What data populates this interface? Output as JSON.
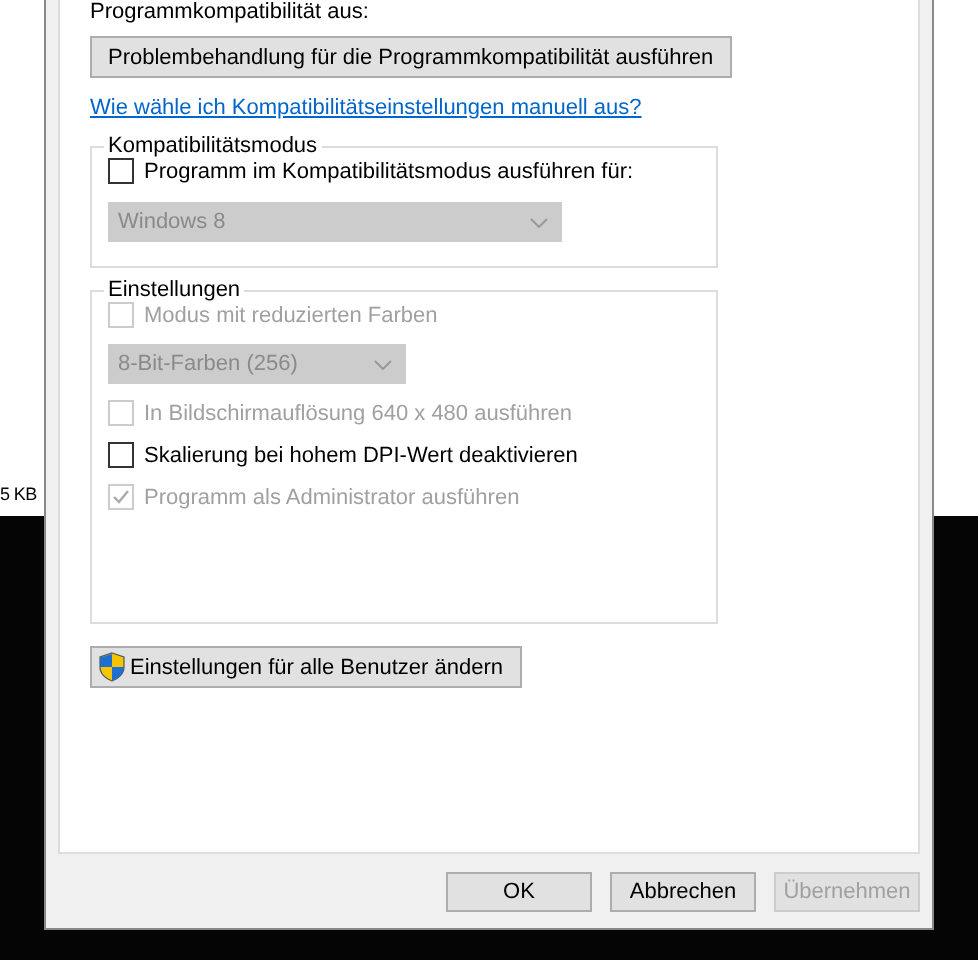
{
  "background_text": "5 KB",
  "intro_text": "Programmkompatibilität aus:",
  "troubleshoot_button": {
    "label": "Problembehandlung für die Programmkompatibilität ausführen"
  },
  "help_link": "Wie wähle ich Kompatibilitätseinstellungen manuell aus?",
  "compat_group": {
    "legend": "Kompatibilitätsmodus",
    "items": [
      {
        "kind": "checkbox",
        "label": "Programm im Kompatibilitätsmodus ausführen für:",
        "checked": false,
        "disabled": false
      },
      {
        "kind": "dropdown",
        "value": "Windows 8",
        "disabled": true
      }
    ]
  },
  "settings_group": {
    "legend": "Einstellungen",
    "items": [
      {
        "kind": "checkbox",
        "label": "Modus mit reduzierten Farben",
        "checked": false,
        "disabled": true
      },
      {
        "kind": "dropdown",
        "value": "8-Bit-Farben (256)",
        "disabled": true
      },
      {
        "kind": "checkbox",
        "label": "In Bildschirmauflösung 640 x 480 ausführen",
        "checked": false,
        "disabled": true
      },
      {
        "kind": "checkbox",
        "label": "Skalierung bei hohem DPI-Wert deaktivieren",
        "checked": false,
        "disabled": false
      },
      {
        "kind": "checkbox",
        "label": "Programm als Administrator ausführen",
        "checked": true,
        "disabled": true
      }
    ]
  },
  "all_users_button": {
    "label": "Einstellungen für alle Benutzer ändern"
  },
  "footer_buttons": [
    {
      "label": "OK",
      "disabled": false
    },
    {
      "label": "Abbrechen",
      "disabled": false
    },
    {
      "label": "Übernehmen",
      "disabled": true
    }
  ]
}
